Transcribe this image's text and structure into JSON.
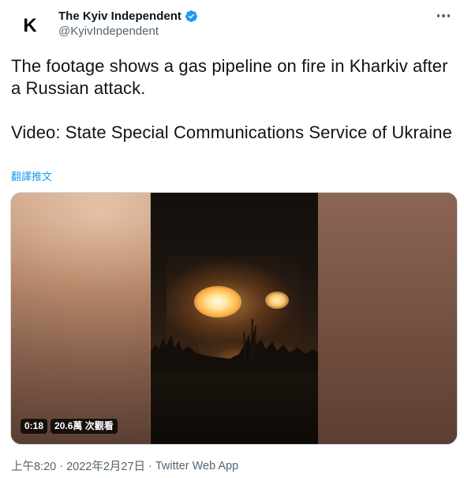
{
  "author": {
    "avatar_letter": "K",
    "display_name": "The Kyiv Independent",
    "handle": "@KyivIndependent",
    "verified_color": "#1d9bf0"
  },
  "tweet": {
    "text_line1": "The footage shows a gas pipeline on fire in Kharkiv after a Russian attack.",
    "text_line2": "Video: State Special Communications Service of Ukraine",
    "translate_label": "翻譯推文"
  },
  "media": {
    "duration": "0:18",
    "views": "20.6萬 次觀看"
  },
  "meta": {
    "time": "上午8:20",
    "separator": "·",
    "date": "2022年2月27日",
    "source": "Twitter Web App"
  },
  "colors": {
    "accent": "#1d9bf0",
    "secondary_text": "#536471",
    "primary_text": "#0f1419"
  },
  "icons": {
    "verified": "verified-badge-icon",
    "more": "more-options-icon"
  }
}
